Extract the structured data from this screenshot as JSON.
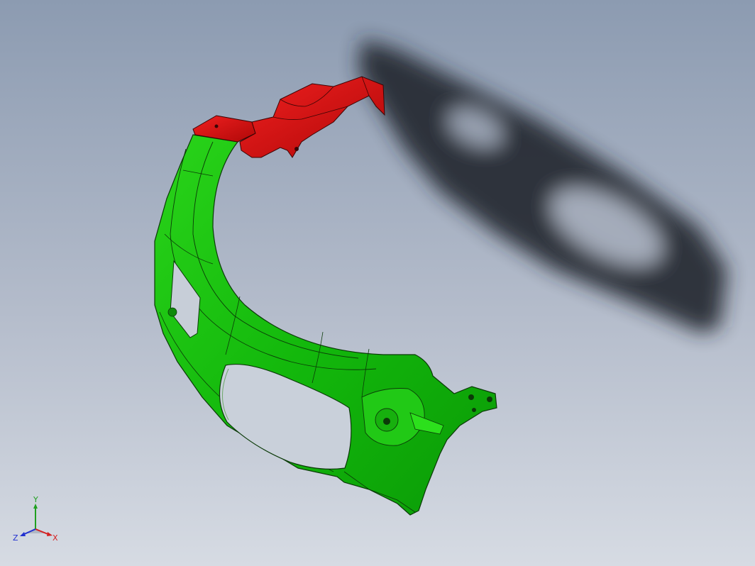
{
  "viewport": {
    "background_top": "#8c9bb1",
    "background_bottom": "#d4d9e2"
  },
  "parts": [
    {
      "name": "green-bumper-part",
      "color": "#1ec40f"
    },
    {
      "name": "red-bracket-part",
      "color": "#e01010"
    }
  ],
  "shadow": {
    "color": "#1e2228"
  },
  "triad": {
    "x_label": "X",
    "y_label": "Y",
    "z_label": "Z",
    "x_color": "#d42020",
    "y_color": "#20a020",
    "z_color": "#2030d0"
  }
}
